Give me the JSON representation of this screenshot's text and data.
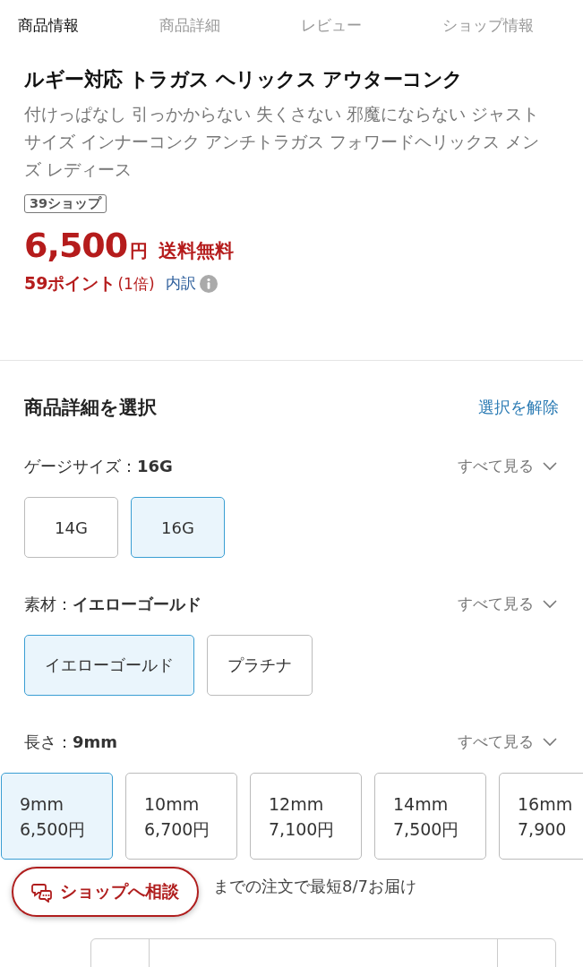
{
  "tabs": [
    {
      "label": "商品情報",
      "selected": true
    },
    {
      "label": "商品詳細",
      "selected": false
    },
    {
      "label": "レビュー",
      "selected": false
    },
    {
      "label": "ショップ情報",
      "selected": false
    }
  ],
  "product": {
    "title": "ルギー対応 トラガス ヘリックス アウターコンク",
    "description": "付けっぱなし 引っかからない 失くさない 邪魔にならない ジャストサイズ インナーコンク アンチトラガス フォワードヘリックス メンズ レディース",
    "badge": "39ショップ",
    "price": "6,500",
    "currency": "円",
    "shipping": "送料無料",
    "points": "59ポイント",
    "multiplier": "(1倍)",
    "breakdown_link": "内訳"
  },
  "selection": {
    "heading": "商品詳細を選択",
    "clear_link": "選択を解除",
    "groups": [
      {
        "label": "ゲージサイズ：",
        "value": "16G",
        "see_all": "すべて見る",
        "kind": "simple",
        "options": [
          {
            "label": "14G",
            "selected": false
          },
          {
            "label": "16G",
            "selected": true
          }
        ]
      },
      {
        "label": "素材：",
        "value": "イエローゴールド",
        "see_all": "すべて見る",
        "kind": "simple",
        "options": [
          {
            "label": "イエローゴールド",
            "selected": true
          },
          {
            "label": "プラチナ",
            "selected": false
          }
        ]
      },
      {
        "label": "長さ：",
        "value": "9mm",
        "see_all": "すべて見る",
        "kind": "priced",
        "options": [
          {
            "label": "9mm",
            "price": "6,500円",
            "selected": true
          },
          {
            "label": "10mm",
            "price": "6,700円",
            "selected": false
          },
          {
            "label": "12mm",
            "price": "7,100円",
            "selected": false
          },
          {
            "label": "14mm",
            "price": "7,500円",
            "selected": false
          },
          {
            "label": "16mm",
            "price": "7,900",
            "selected": false
          }
        ]
      }
    ]
  },
  "delivery": "までの注文で最短8/7お届け",
  "consult_button": "ショップへ相談"
}
